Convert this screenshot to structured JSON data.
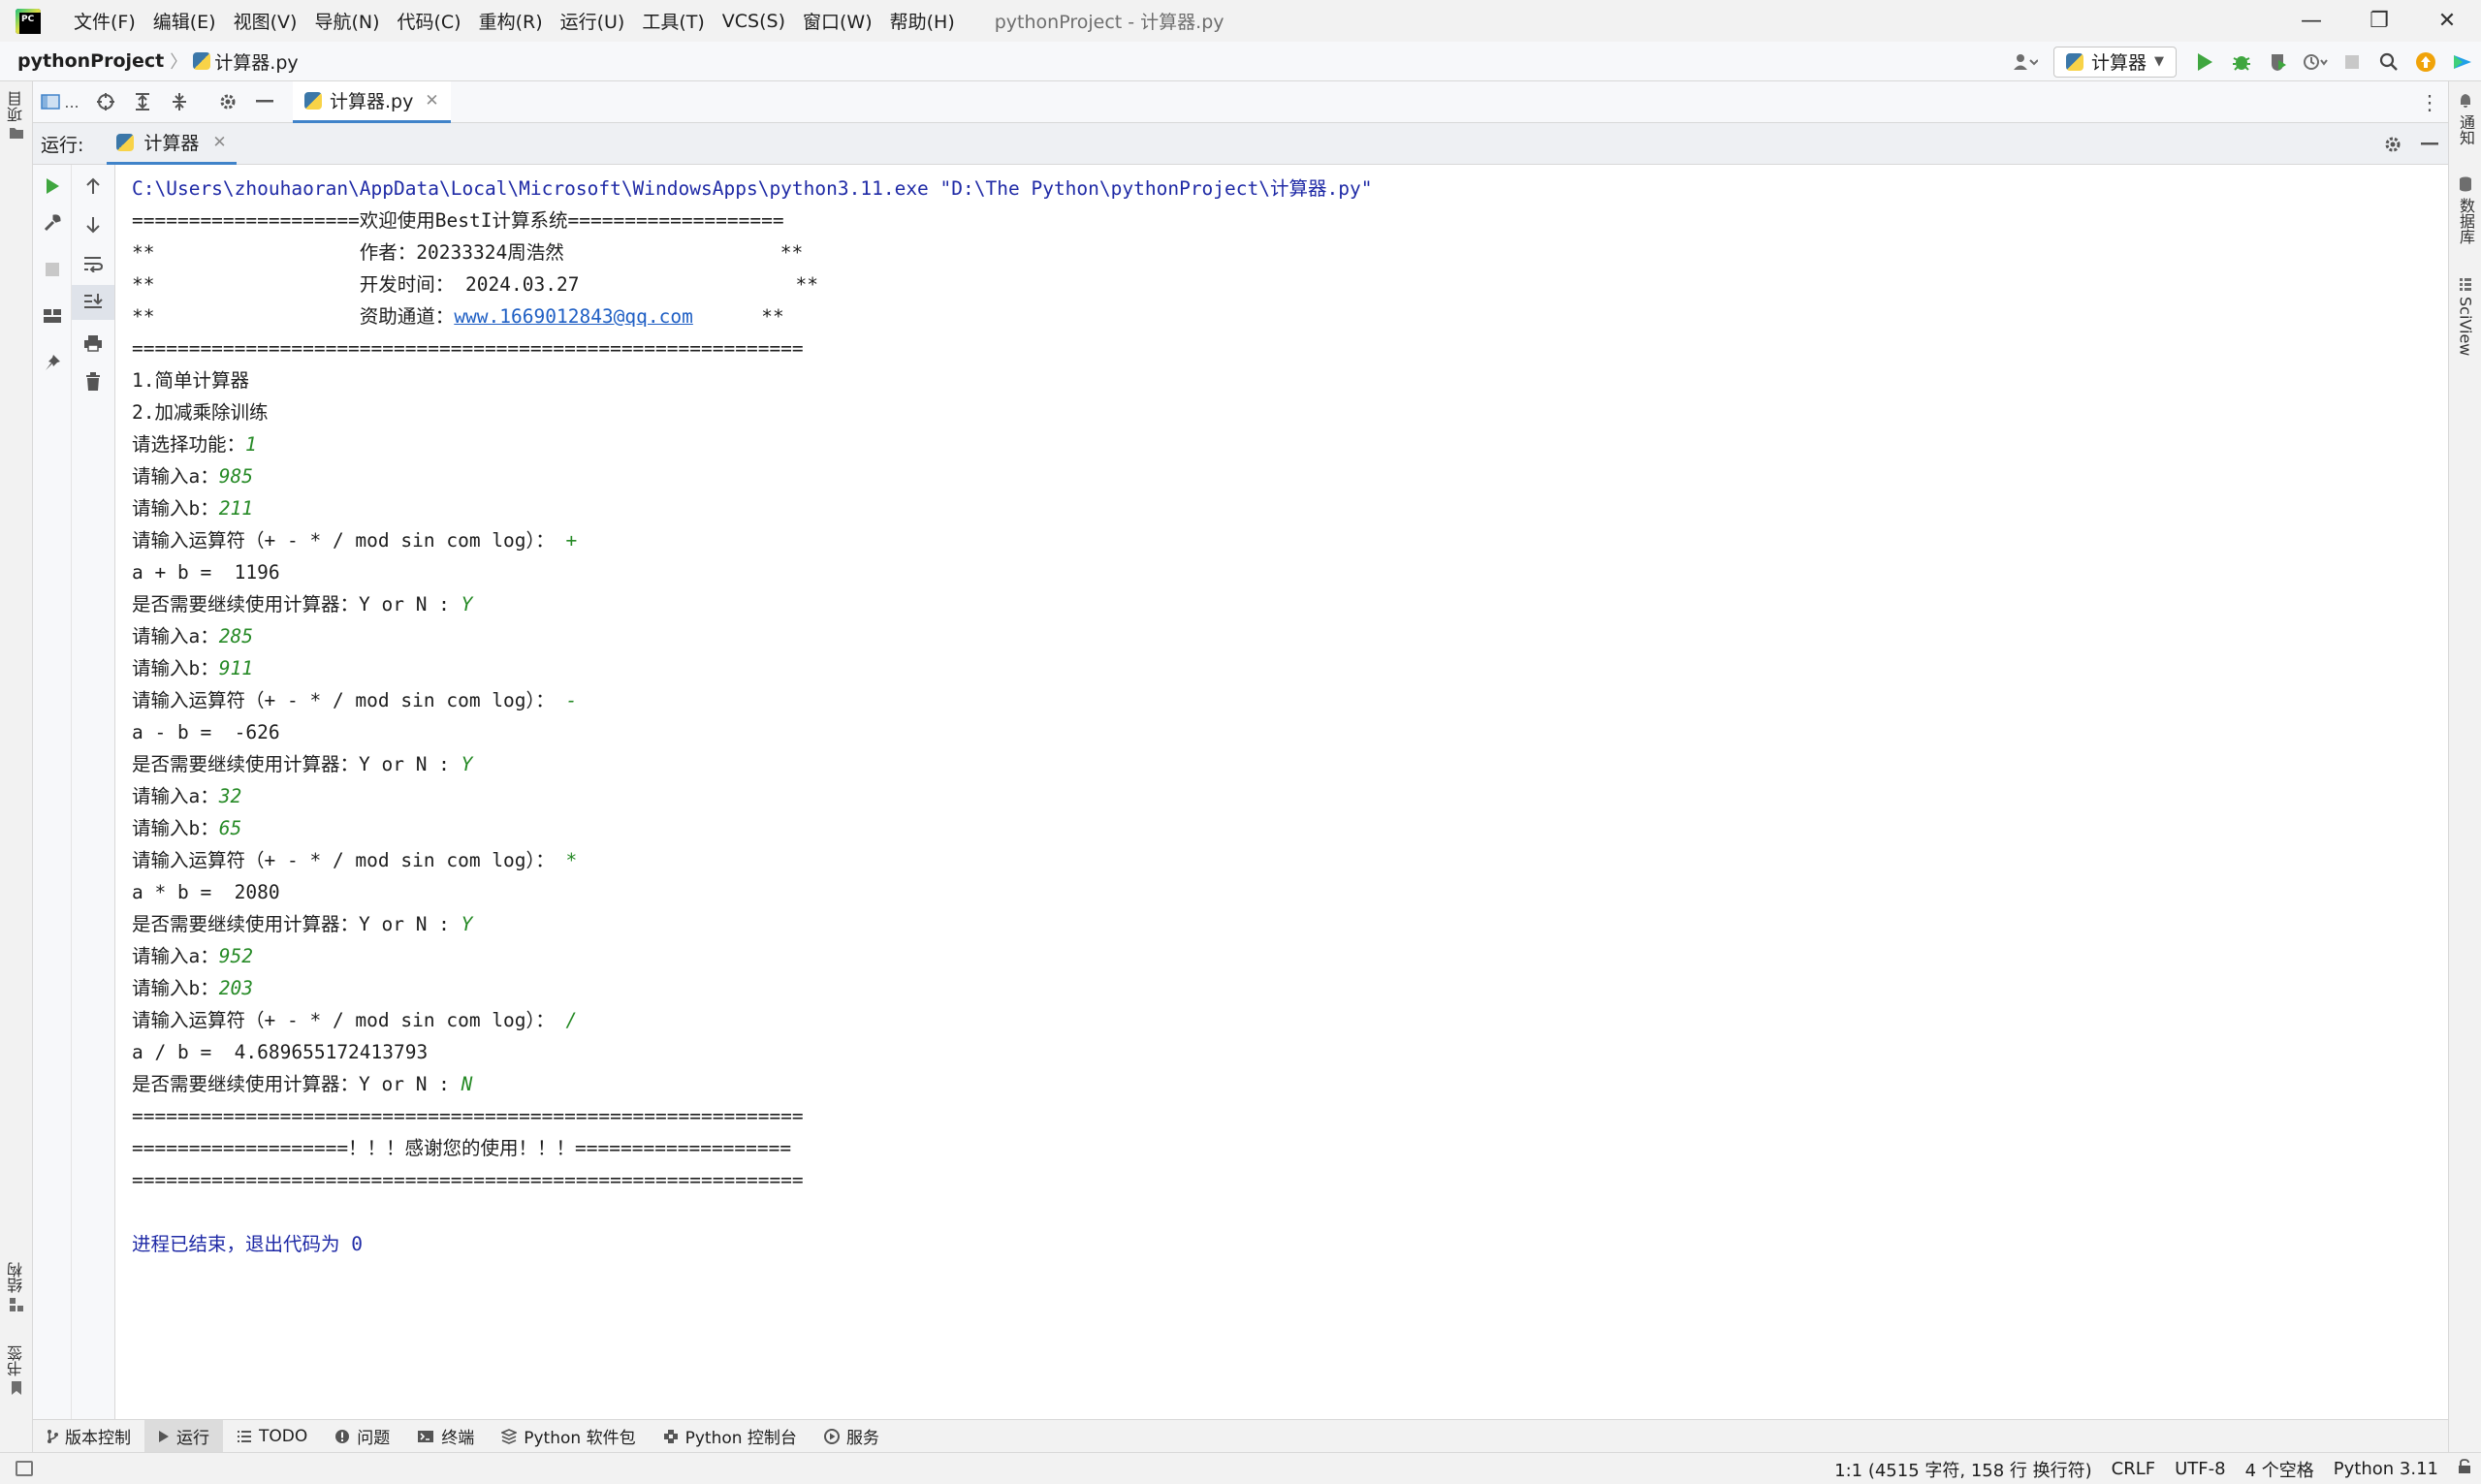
{
  "titlebar": {
    "menu": [
      "文件(F)",
      "编辑(E)",
      "视图(V)",
      "导航(N)",
      "代码(C)",
      "重构(R)",
      "运行(U)",
      "工具(T)",
      "VCS(S)",
      "窗口(W)",
      "帮助(H)"
    ],
    "window_title": "pythonProject - 计算器.py",
    "controls": {
      "minimize": "—",
      "restore": "❐",
      "close": "✕"
    }
  },
  "navbar": {
    "project": "pythonProject",
    "separator": "〉",
    "file": "计算器.py",
    "run_config": "计算器"
  },
  "left_strip": {
    "project_tab": "项目",
    "structure_tab": "结构",
    "bookmarks_tab": "书签"
  },
  "right_strip": {
    "notifications_tab": "通知",
    "database_tab": "数据库",
    "sciview_tab": "SciView"
  },
  "editor": {
    "tab_label": "计算器.py",
    "toolbar_ellipsis": "..."
  },
  "run_window": {
    "label": "运行:",
    "tab_label": "计算器"
  },
  "console": {
    "command": "C:\\Users\\zhouhaoran\\AppData\\Local\\Microsoft\\WindowsApps\\python3.11.exe \"D:\\The Python\\pythonProject\\计算器.py\"",
    "banner_top": "====================欢迎使用BestI计算系统===================",
    "author_line": "**                  作者：20233324周浩然                   **",
    "date_line": "**                  开发时间： 2024.03.27                   **",
    "support_prefix": "**                  资助通道：",
    "support_link": "www.1669012843@qq.com",
    "support_suffix": "      **",
    "banner_bottom": "===========================================================",
    "menu_1": "1.简单计算器",
    "menu_2": "2.加减乘除训练",
    "choose_prompt": "请选择功能：",
    "choose_value": "1",
    "prompt_a": "请输入a：",
    "prompt_b": "请输入b：",
    "prompt_op": "请输入运算符（+ - * / mod sin com log）： ",
    "prompt_continue": "是否需要继续使用计算器：Y or N : ",
    "rounds": [
      {
        "a": "985",
        "b": "211",
        "op": "+",
        "result": "a + b =  1196",
        "cont": "Y"
      },
      {
        "a": "285",
        "b": "911",
        "op": "-",
        "result": "a - b =  -626",
        "cont": "Y"
      },
      {
        "a": "32",
        "b": "65",
        "op": "*",
        "result": "a * b =  2080",
        "cont": "Y"
      },
      {
        "a": "952",
        "b": "203",
        "op": "/",
        "result": "a / b =  4.689655172413793",
        "cont": "N"
      }
    ],
    "end_rule_1": "===========================================================",
    "thanks_line": "===================！！！感谢您的使用！！！===================",
    "end_rule_2": "===========================================================",
    "exit_message": "进程已结束，退出代码为 0"
  },
  "bottom_tabs": [
    "版本控制",
    "运行",
    "TODO",
    "问题",
    "终端",
    "Python 软件包",
    "Python 控制台",
    "服务"
  ],
  "statusbar": {
    "position": "1:1 (4515 字符, 158 行 换行符)",
    "line_sep": "CRLF",
    "encoding": "UTF-8",
    "indent": "4 个空格",
    "interpreter": "Python 3.11"
  },
  "colors": {
    "accent": "#4083c9",
    "console_command": "#1f2aa6",
    "user_input": "#268a26",
    "link": "#1f5fc4",
    "run_green": "#3fa63f"
  }
}
